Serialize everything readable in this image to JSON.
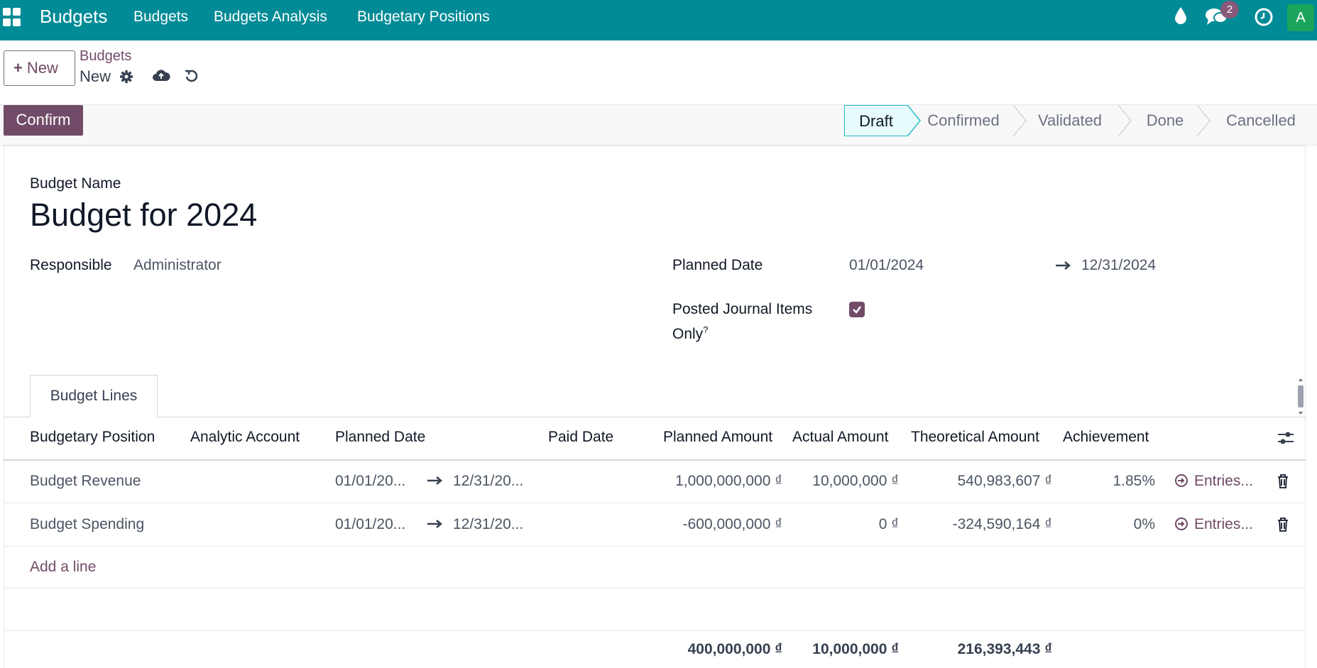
{
  "navbar": {
    "brand": "Budgets",
    "menu": [
      "Budgets",
      "Budgets Analysis",
      "Budgetary Positions"
    ],
    "messages_badge": "2",
    "avatar_initial": "A",
    "icons": [
      "apps-icon",
      "droplet-icon",
      "chat-icon",
      "clock-icon"
    ]
  },
  "control": {
    "new_label": "New",
    "breadcrumb": "Budgets",
    "record_title": "New",
    "icons": [
      "gear-icon",
      "cloud-upload-icon",
      "discard-icon"
    ]
  },
  "statusbar": {
    "confirm_label": "Confirm",
    "stages": [
      "Draft",
      "Confirmed",
      "Validated",
      "Done",
      "Cancelled"
    ],
    "active_stage": "Draft"
  },
  "form": {
    "budget_name_label": "Budget Name",
    "budget_name": "Budget for 2024",
    "responsible_label": "Responsible",
    "responsible": "Administrator",
    "planned_date_label": "Planned Date",
    "date_from": "01/01/2024",
    "date_to": "12/31/2024",
    "posted_label_1": "Posted Journal Items",
    "posted_label_2": "Only",
    "posted_help": "?",
    "posted_checked": true
  },
  "tabs": [
    "Budget Lines"
  ],
  "table": {
    "headers": [
      "Budgetary Position",
      "Analytic Account",
      "Planned Date",
      "Paid Date",
      "Planned Amount",
      "Actual Amount",
      "Theoretical Amount",
      "Achievement"
    ],
    "rows": [
      {
        "position": "Budget Revenue",
        "analytic": "",
        "date_from": "01/01/20...",
        "date_to": "12/31/20...",
        "paid": "",
        "planned": "1,000,000,000 ₫",
        "actual": "10,000,000 ₫",
        "theoretical": "540,983,607 ₫",
        "achievement": "1.85%",
        "entries": "Entries..."
      },
      {
        "position": "Budget Spending",
        "analytic": "",
        "date_from": "01/01/20...",
        "date_to": "12/31/20...",
        "paid": "",
        "planned": "-600,000,000 ₫",
        "actual": "0 ₫",
        "theoretical": "-324,590,164 ₫",
        "achievement": "0%",
        "entries": "Entries..."
      }
    ],
    "add_line": "Add a line",
    "totals": {
      "planned": "400,000,000 ₫",
      "actual": "10,000,000 ₫",
      "theoretical": "216,393,443 ₫"
    }
  },
  "colors": {
    "navbar": "#018b96",
    "primary": "#714b67",
    "active_stage_bg": "#e6fbfc",
    "avatar": "#1ba45c"
  }
}
